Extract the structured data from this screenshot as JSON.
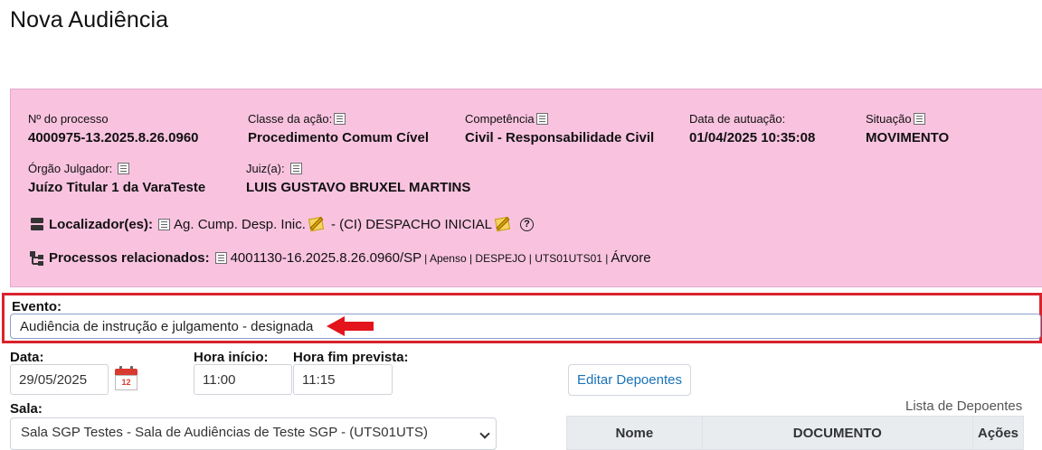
{
  "page": {
    "title": "Nova Audiência"
  },
  "processo": {
    "numero": {
      "label": "Nº do processo",
      "value": "4000975-13.2025.8.26.0960"
    },
    "classe": {
      "label": "Classe da ação:",
      "value": "Procedimento Comum Cível"
    },
    "competencia": {
      "label": "Competência",
      "value": "Civil - Responsabilidade Civil"
    },
    "data_autuacao": {
      "label": "Data de autuação:",
      "value": "01/04/2025 10:35:08"
    },
    "situacao": {
      "label": "Situação",
      "value": "MOVIMENTO"
    },
    "orgao": {
      "label": "Órgão Julgador:",
      "value": "Juízo Titular 1 da VaraTeste"
    },
    "juiz": {
      "label": "Juiz(a):",
      "value": "LUIS GUSTAVO BRUXEL MARTINS"
    },
    "localizador": {
      "label": "Localizador(es):",
      "item1": "Ag. Cump. Desp. Inic.",
      "item2": "- (CI) DESPACHO INICIAL"
    },
    "relacionados": {
      "label": "Processos relacionados:",
      "numero": "4001130-16.2025.8.26.0960/SP",
      "tipo": "| Apenso | DESPEJO | UTS01UTS01 |",
      "arvore": "Árvore"
    }
  },
  "form": {
    "evento": {
      "label": "Evento:",
      "value": "Audiência de instrução e julgamento - designada"
    },
    "data": {
      "label": "Data:",
      "value": "29/05/2025"
    },
    "hora_inicio": {
      "label": "Hora início:",
      "value": "11:00"
    },
    "hora_fim": {
      "label": "Hora fim prevista:",
      "value": "11:15"
    },
    "sala": {
      "label": "Sala:",
      "value": "Sala SGP Testes - Sala de Audiências de Teste SGP - (UTS01UTS)"
    },
    "editar_depoentes": "Editar Depoentes",
    "calendar_day": "12"
  },
  "depoentes": {
    "caption": "Lista de Depoentes",
    "columns": [
      "Nome",
      "DOCUMENTO",
      "Ações"
    ]
  },
  "icons": [
    "info-list-icon",
    "pencil-note-icon",
    "help-icon",
    "locator-icon",
    "tree-icon",
    "calendar-icon",
    "red-arrow-icon",
    "chevron-down-icon"
  ],
  "colors": {
    "panel_bg": "#f9c3e0",
    "highlight": "#d9232d",
    "link": "#1a73b8"
  }
}
